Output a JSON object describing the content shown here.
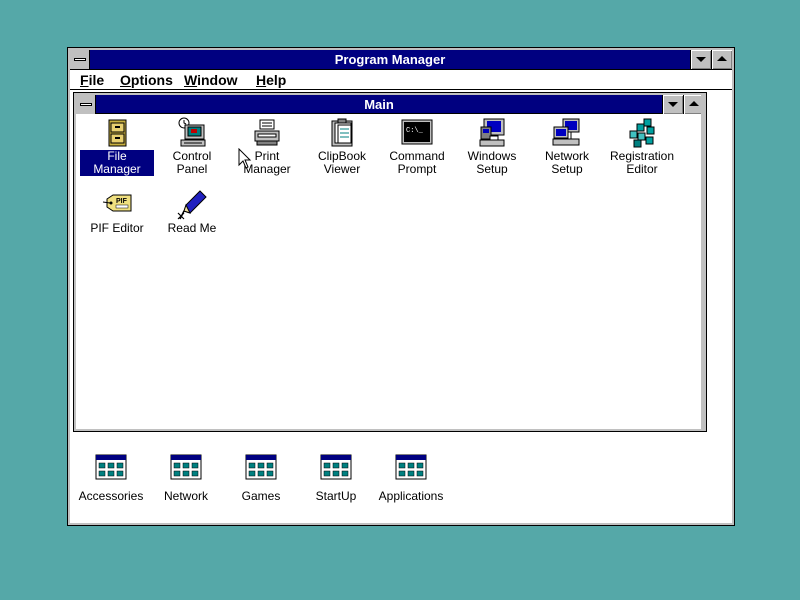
{
  "window": {
    "title": "Program Manager",
    "menu": [
      {
        "label": "File",
        "hotkey": "F",
        "rest": "ile"
      },
      {
        "label": "Options",
        "hotkey": "O",
        "rest": "ptions"
      },
      {
        "label": "Window",
        "hotkey": "W",
        "rest": "indow"
      },
      {
        "label": "Help",
        "hotkey": "H",
        "rest": "elp"
      }
    ]
  },
  "main": {
    "title": "Main",
    "icons": [
      {
        "label": "File Manager",
        "icon": "file-cabinet-icon",
        "selected": true
      },
      {
        "label": "Control Panel",
        "icon": "control-panel-icon"
      },
      {
        "label": "Print Manager",
        "icon": "printer-icon"
      },
      {
        "label": "ClipBook\nViewer",
        "icon": "clipbook-icon"
      },
      {
        "label": "Command\nPrompt",
        "icon": "command-prompt-icon"
      },
      {
        "label": "Windows\nSetup",
        "icon": "windows-setup-icon"
      },
      {
        "label": "Network Setup",
        "icon": "network-setup-icon"
      },
      {
        "label": "Registration\nEditor",
        "icon": "registration-editor-icon"
      },
      {
        "label": "PIF Editor",
        "icon": "pif-editor-icon"
      },
      {
        "label": "Read Me",
        "icon": "read-me-icon"
      }
    ]
  },
  "groups": [
    {
      "label": "Accessories"
    },
    {
      "label": "Network"
    },
    {
      "label": "Games"
    },
    {
      "label": "StartUp"
    },
    {
      "label": "Applications"
    }
  ],
  "pif_badge": "PIF",
  "prompt_text": "C:\\_",
  "colors": {
    "desktop": "#55a8a8",
    "titlebar": "#000080",
    "chrome": "#c0c0c0"
  }
}
